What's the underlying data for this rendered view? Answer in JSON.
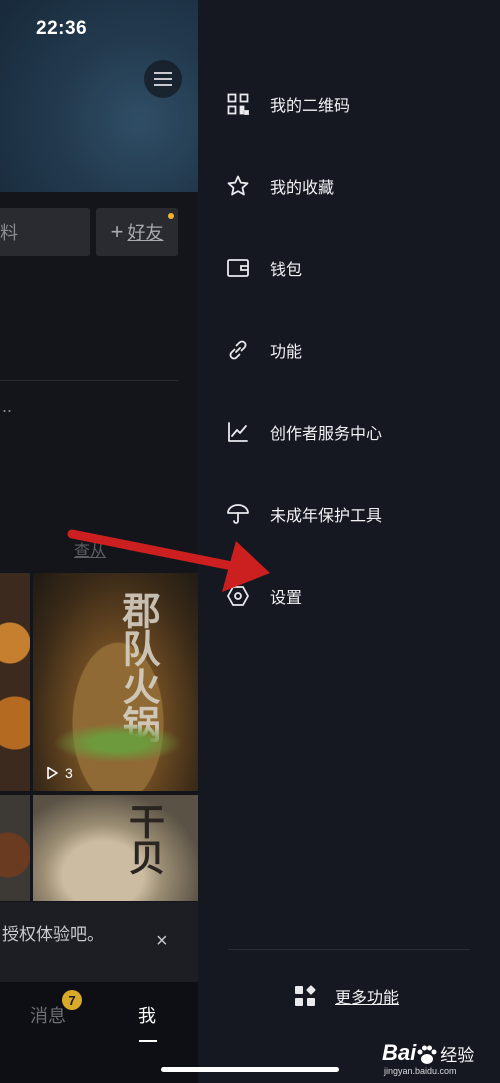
{
  "status_bar": {
    "time": "22:36"
  },
  "background_app": {
    "edit_chip_text": "料",
    "friend_chip": {
      "plus": "+",
      "label": "好友"
    },
    "ellipsis": "..",
    "link_text": "查从",
    "video": {
      "play_count": "3",
      "calligraphy_1": "郡队火锅",
      "calligraphy_2": "干贝"
    },
    "toast": {
      "text": "授权体验吧。",
      "close": "×"
    },
    "tabbar": {
      "messages_label": "消息",
      "messages_badge": "7",
      "me_label": "我"
    }
  },
  "drawer": {
    "items": [
      {
        "label": "我的二维码",
        "icon": "qr-code-icon"
      },
      {
        "label": "我的收藏",
        "icon": "star-icon"
      },
      {
        "label": "钱包",
        "icon": "wallet-icon"
      },
      {
        "label": "功能",
        "icon": "link-icon"
      },
      {
        "label": "创作者服务中心",
        "icon": "chart-icon"
      },
      {
        "label": "未成年保护工具",
        "icon": "umbrella-icon"
      },
      {
        "label": "设置",
        "icon": "settings-hexagon-icon"
      }
    ],
    "more": {
      "label": "更多功能",
      "icon": "apps-grid-icon"
    }
  },
  "watermark": {
    "brand": "Bai",
    "brand_suffix": "经验",
    "url": "jingyan.baidu.com"
  },
  "annotation": {
    "arrow_color": "#cc1f1f"
  }
}
